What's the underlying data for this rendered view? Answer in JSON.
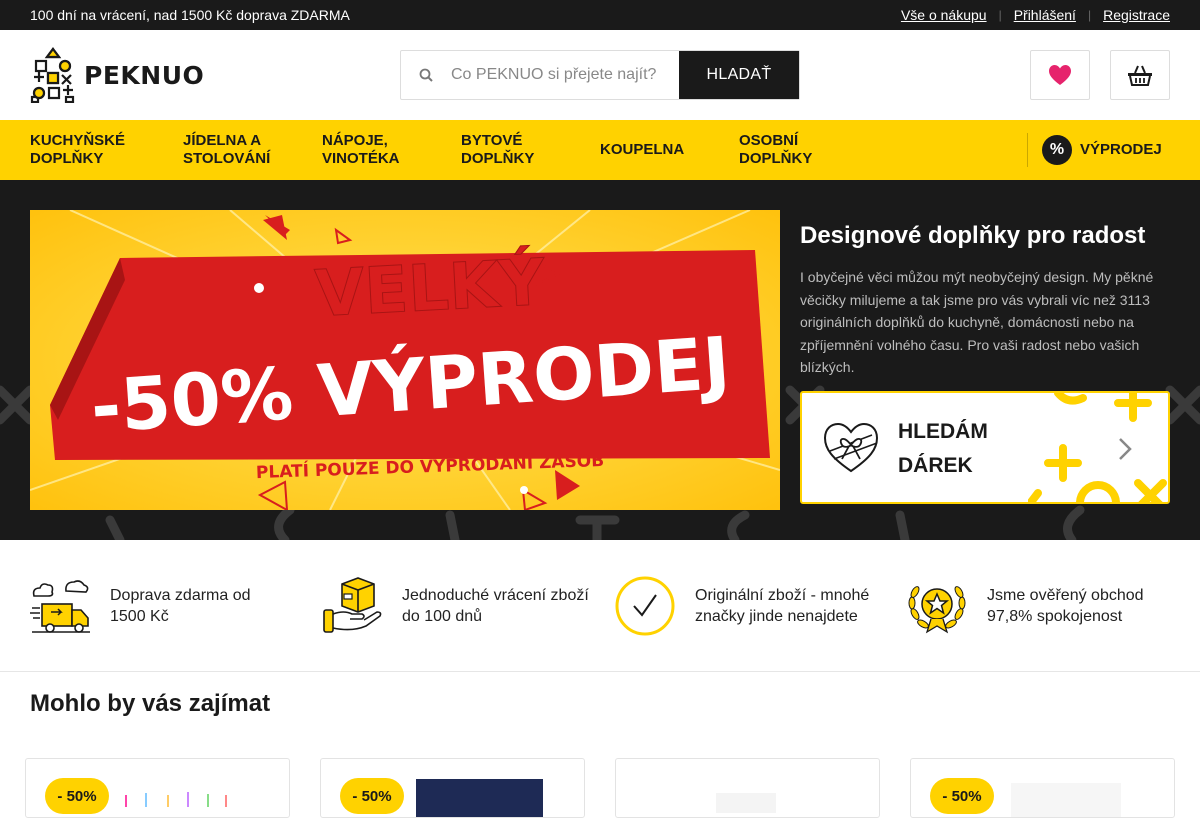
{
  "topbar": {
    "promo": "100 dní na vrácení, nad 1500 Kč doprava ZDARMA",
    "links": [
      "Vše o nákupu",
      "Přihlášení",
      "Registrace"
    ]
  },
  "header": {
    "logo_text": "PEKNUO",
    "search_placeholder": "Co PEKNUO si přejete najít?",
    "search_button": "HLADAŤ"
  },
  "nav": {
    "items": [
      {
        "label": "KUCHYŇSKÉ DOPLŇKY",
        "l1": "KUCHYŇSKÉ",
        "l2": "DOPLŇKY"
      },
      {
        "label": "JÍDELNA A STOLOVÁNÍ",
        "l1": "JÍDELNA A",
        "l2": "STOLOVÁNÍ"
      },
      {
        "label": "NÁPOJE, VINOTÉKA",
        "l1": "NÁPOJE,",
        "l2": "VINOTÉKA"
      },
      {
        "label": "BYTOVÉ DOPLŇKY",
        "l1": "BYTOVÉ",
        "l2": "DOPLŇKY"
      },
      {
        "label": "KOUPELNA",
        "l1": "KOUPELNA",
        "l2": ""
      },
      {
        "label": "OSOBNÍ DOPLŇKY",
        "l1": "OSOBNÍ",
        "l2": "DOPLŇKY"
      }
    ],
    "sale_badge": "%",
    "sale_label": "VÝPRODEJ"
  },
  "banner": {
    "line1": "VELKÝ",
    "line2": "-50% VÝPRODEJ",
    "line3": "PLATÍ  POUZE DO VYPRODÁNÍ ZÁSOB"
  },
  "hero": {
    "title": "Designové doplňky pro radost",
    "description": "I obyčejné věci můžou mýt neobyčejný design. My pěkné věcičky milujeme a tak jsme pro vás vybrali víc než 3113 originálních doplňků do kuchyně, domácnosti nebo na zpříjemnění volného času. Pro vaši radost nebo vašich blízkých.",
    "gift_line1": "HLEDÁM",
    "gift_line2": "DÁREK"
  },
  "features": [
    {
      "icon": "truck-icon",
      "l1": "Doprava zdarma od",
      "l2": "1500 Kč"
    },
    {
      "icon": "box-hand-icon",
      "l1": "Jednoduché vrácení zboží",
      "l2": "do 100 dnů"
    },
    {
      "icon": "check-circle-icon",
      "l1": "Originální zboží - mnohé",
      "l2": "značky jinde nenajdete"
    },
    {
      "icon": "award-star-icon",
      "l1": "Jsme ověřený obchod",
      "l2": "97,8% spokojenost"
    }
  ],
  "section": {
    "title": "Mohlo by vás zajímat"
  },
  "products": [
    {
      "discount": "- 50%"
    },
    {
      "discount": "- 50%"
    },
    {
      "discount": ""
    },
    {
      "discount": "- 50%"
    }
  ],
  "colors": {
    "accent": "#ffd200",
    "dark": "#1a1a1a",
    "sale_red": "#d81e1e"
  }
}
